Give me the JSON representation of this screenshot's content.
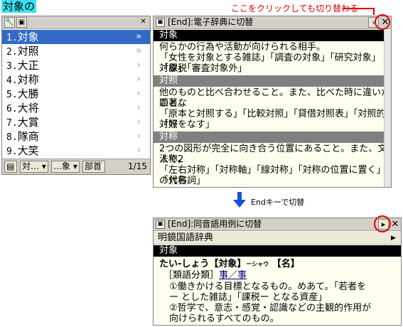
{
  "input_text": "対象の",
  "candidate_window": {
    "toolbar_icons": [
      "wrench-icon",
      "copy-icon"
    ],
    "close_label": "✕",
    "candidates": [
      {
        "num": "1.",
        "word": "対象",
        "arrow": "»"
      },
      {
        "num": "2.",
        "word": "対照",
        "arrow": "»"
      },
      {
        "num": "3.",
        "word": "大正",
        "arrow": "›"
      },
      {
        "num": "4.",
        "word": "対称",
        "arrow": "›"
      },
      {
        "num": "5.",
        "word": "大勝",
        "arrow": "›"
      },
      {
        "num": "6.",
        "word": "大将",
        "arrow": "›"
      },
      {
        "num": "7.",
        "word": "大賞",
        "arrow": "›"
      },
      {
        "num": "8.",
        "word": "隊商",
        "arrow": "›"
      },
      {
        "num": "9.",
        "word": "大笑",
        "arrow": "›"
      }
    ],
    "selected_index": 0,
    "bottom": {
      "btn1": "対…",
      "btn2": "…象",
      "btn3": "部首",
      "page": "1/15"
    }
  },
  "dict_window_1": {
    "title": "[End]:電子辞典に切替",
    "nav": "›",
    "close": "✕",
    "entries": [
      {
        "head": "対象",
        "lines": [
          "何らかの行為や活動が向けられる相手。",
          "「女性を対象とする雑誌」「調査の対象」「研究対象」「課税",
          "対象」「審査対象外」"
        ]
      },
      {
        "head": "対照",
        "lines": [
          "他のものと比べ合わせること。また、比べた時に違いが顕著な",
          "こと。",
          "「原本と対照する」「比較対照」「貸借対照表」「対照的」「好",
          "対照をなす」"
        ]
      },
      {
        "head": "対称",
        "lines": [
          "2つの図形が完全に向き合う位置にあること。また、文法で2",
          "人称。",
          "「左右対称」「対称軸」「線対称」「対称の位置に置く」「対称",
          "の代名詞」"
        ]
      }
    ]
  },
  "dict_window_2": {
    "title": "[End]:同音語用例に切替",
    "nav": "▸",
    "close": "✕",
    "dictionary_name": "明鏡国語辞典",
    "entry_head": "対象",
    "headword": "たい‐しょう【対象】",
    "reading_sup": "ーシャウ",
    "pos": "【名】",
    "category_label": "［類語分類］",
    "category_link": "事／事",
    "lines": [
      "①働きかける目標となるもの。めあて。「若者を",
      "ー とした雑誌」「課税ー となる資産」",
      "②哲学で、意志・感覚・認識などの主観的作用が",
      "向けられるすべてのもの。"
    ]
  },
  "annotations": {
    "callout": "ここをクリックしても切り替わる",
    "arrow_caption": "Endキーで切替",
    "accent_red": "#e00000",
    "accent_blue": "#1a4fd6"
  },
  "colors": {
    "selection": "#3169c6",
    "input_highlight": "#37e3f0",
    "dict_bg": "#fffff0"
  }
}
